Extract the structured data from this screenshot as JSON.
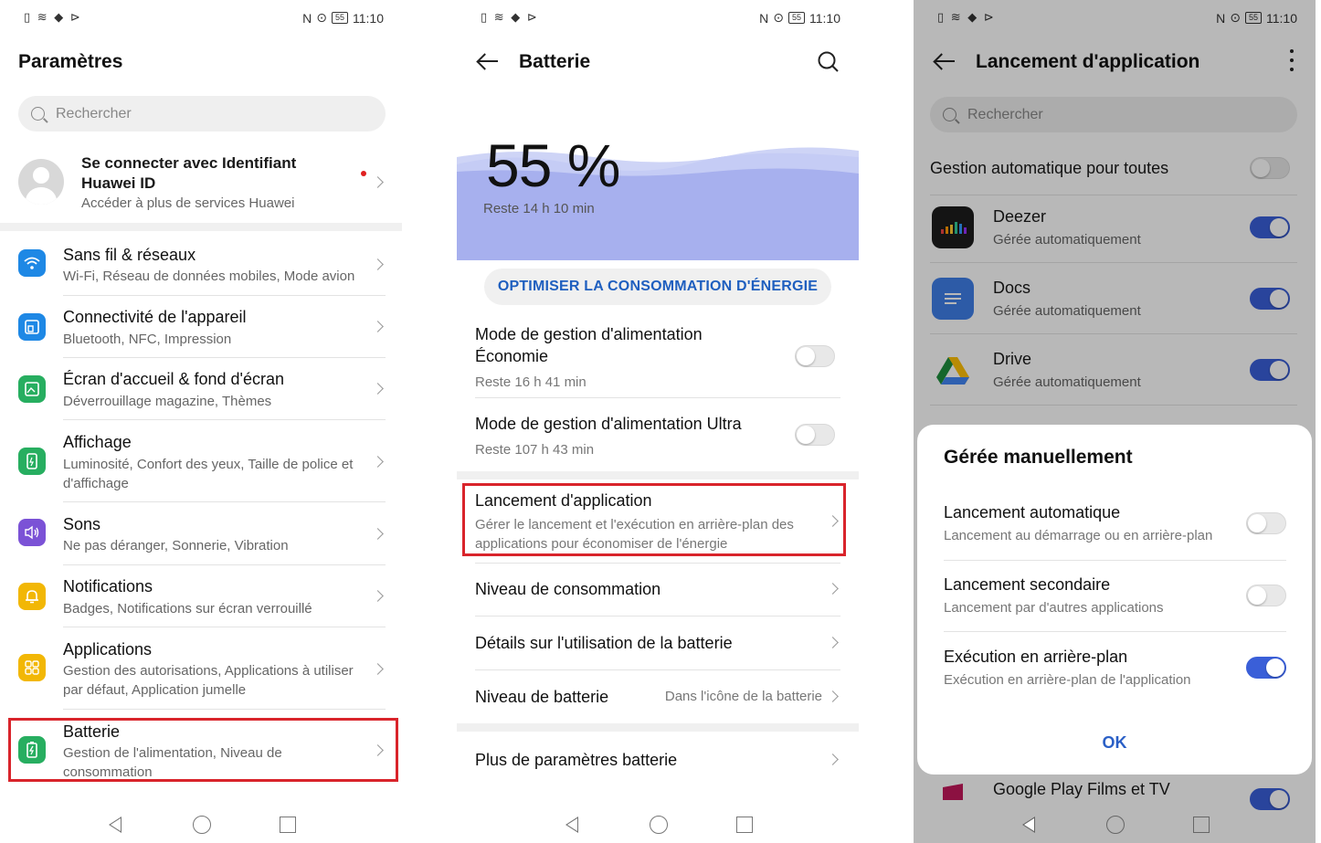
{
  "status_bar": {
    "left_icons": "▯ ≋ ◆ ⊳",
    "nfc": "N",
    "batt": "55",
    "time": "11:10"
  },
  "screen1": {
    "title": "Paramètres",
    "search_placeholder": "Rechercher",
    "account": {
      "name": "Se connecter avec Identifiant Huawei ID",
      "sub": "Accéder à plus de services Huawei"
    },
    "items": [
      {
        "label": "Sans fil & réseaux",
        "desc": "Wi-Fi, Réseau de données mobiles, Mode avion",
        "color": "#1e88e5",
        "icon": "wifi-icon"
      },
      {
        "label": "Connectivité de l'appareil",
        "desc": "Bluetooth, NFC, Impression",
        "color": "#1e88e5",
        "icon": "device-connectivity-icon"
      },
      {
        "label": "Écran d'accueil & fond d'écran",
        "desc": "Déverrouillage magazine, Thèmes",
        "color": "#27ae60",
        "icon": "wallpaper-icon"
      },
      {
        "label": "Affichage",
        "desc": "Luminosité, Confort des yeux, Taille de police et d'affichage",
        "color": "#27ae60",
        "icon": "display-icon"
      },
      {
        "label": "Sons",
        "desc": "Ne pas déranger, Sonnerie, Vibration",
        "color": "#7b52d6",
        "icon": "sound-icon"
      },
      {
        "label": "Notifications",
        "desc": "Badges, Notifications sur écran verrouillé",
        "color": "#f2b705",
        "icon": "bell-icon"
      },
      {
        "label": "Applications",
        "desc": "Gestion des autorisations, Applications à utiliser par défaut, Application jumelle",
        "color": "#f2b705",
        "icon": "apps-icon"
      },
      {
        "label": "Batterie",
        "desc": "Gestion de l'alimentation, Niveau de consommation",
        "color": "#27ae60",
        "icon": "battery-icon"
      }
    ]
  },
  "screen2": {
    "title": "Batterie",
    "percent": "55 %",
    "remaining": "Reste 14 h 10 min",
    "optimize_label": "OPTIMISER LA CONSOMMATION D'ÉNERGIE",
    "mode_eco": {
      "title": "Mode de gestion d'alimentation Économie",
      "sub": "Reste 16 h 41 min",
      "on": false
    },
    "mode_ultra": {
      "title": "Mode de gestion d'alimentation Ultra",
      "sub": "Reste 107 h 43 min",
      "on": false
    },
    "app_launch": {
      "title": "Lancement d'application",
      "sub": "Gérer le lancement et l'exécution en arrière-plan des applications pour économiser de l'énergie"
    },
    "consumption": "Niveau de consommation",
    "details": "Détails sur l'utilisation de la batterie",
    "battery_level": {
      "label": "Niveau de batterie",
      "value": "Dans l'icône de la batterie"
    },
    "more": "Plus de paramètres batterie"
  },
  "screen3": {
    "title": "Lancement d'application",
    "search_placeholder": "Rechercher",
    "auto_all": "Gestion automatique pour toutes",
    "apps": [
      {
        "name": "Deezer",
        "status": "Gérée automatiquement",
        "on": true
      },
      {
        "name": "Docs",
        "status": "Gérée automatiquement",
        "on": true
      },
      {
        "name": "Drive",
        "status": "Gérée automatiquement",
        "on": true
      }
    ],
    "bottom_app": "Google Play Films et TV",
    "dialog": {
      "title": "Gérée manuellement",
      "auto_launch": {
        "title": "Lancement automatique",
        "sub": "Lancement au démarrage ou en arrière-plan",
        "on": false
      },
      "secondary": {
        "title": "Lancement secondaire",
        "sub": "Lancement par d'autres applications",
        "on": false
      },
      "background": {
        "title": "Exécution en arrière-plan",
        "sub": "Exécution en arrière-plan de l'application",
        "on": true
      },
      "ok": "OK"
    }
  }
}
